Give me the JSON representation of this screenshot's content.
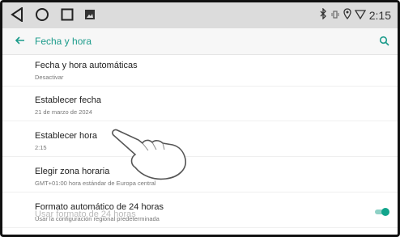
{
  "status": {
    "nav_icons": [
      "back-triangle",
      "home-circle",
      "recents-square",
      "image-thumb"
    ],
    "time": "2:15"
  },
  "appbar": {
    "title": "Fecha y hora"
  },
  "settings": [
    {
      "title": "Fecha y hora automáticas",
      "subtitle": "Desactivar"
    },
    {
      "title": "Establecer fecha",
      "subtitle": "21 de marzo de 2024"
    },
    {
      "title": "Establecer hora",
      "subtitle": "2:15"
    },
    {
      "title": "Elegir zona horaria",
      "subtitle": "GMT+01:00 hora estándar de Europa central"
    },
    {
      "title": "Formato automático de 24 horas",
      "subtitle": "Usar la configuración regional predeterminada",
      "toggle": true
    }
  ],
  "faded_item": "Usar formato de 24 horas",
  "colors": {
    "accent": "#1b9b8b",
    "statusbar": "#dcdcdc"
  }
}
